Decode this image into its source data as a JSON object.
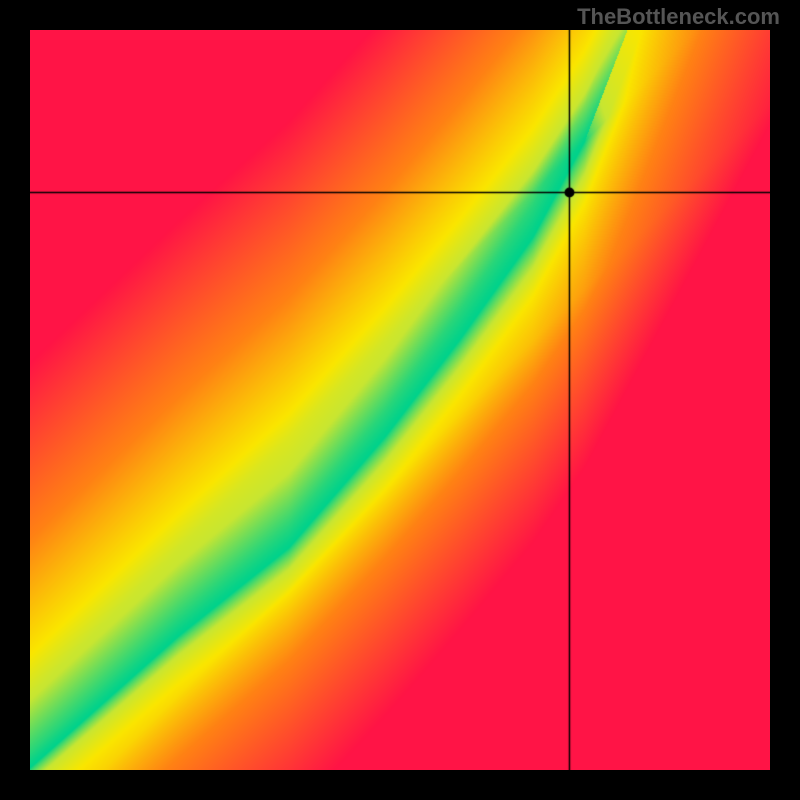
{
  "watermark": "TheBottleneck.com",
  "chart_data": {
    "type": "heatmap",
    "title": "",
    "xlabel": "",
    "ylabel": "",
    "xlim": [
      0,
      1
    ],
    "ylim": [
      0,
      1
    ],
    "crosshair": {
      "x": 0.73,
      "y": 0.78
    },
    "marker": {
      "x": 0.73,
      "y": 0.78
    },
    "colorscale": "red-yellow-green diverging",
    "optimal_path_approx": [
      {
        "x": 0.02,
        "y": 0.02
      },
      {
        "x": 0.2,
        "y": 0.18
      },
      {
        "x": 0.35,
        "y": 0.3
      },
      {
        "x": 0.48,
        "y": 0.45
      },
      {
        "x": 0.58,
        "y": 0.58
      },
      {
        "x": 0.68,
        "y": 0.72
      },
      {
        "x": 0.75,
        "y": 0.85
      },
      {
        "x": 0.8,
        "y": 0.98
      }
    ],
    "description": "Bottleneck heatmap. Green ridge = balanced configuration. Red/orange = bottleneck. Crosshair marks selected configuration near optimal ridge."
  }
}
